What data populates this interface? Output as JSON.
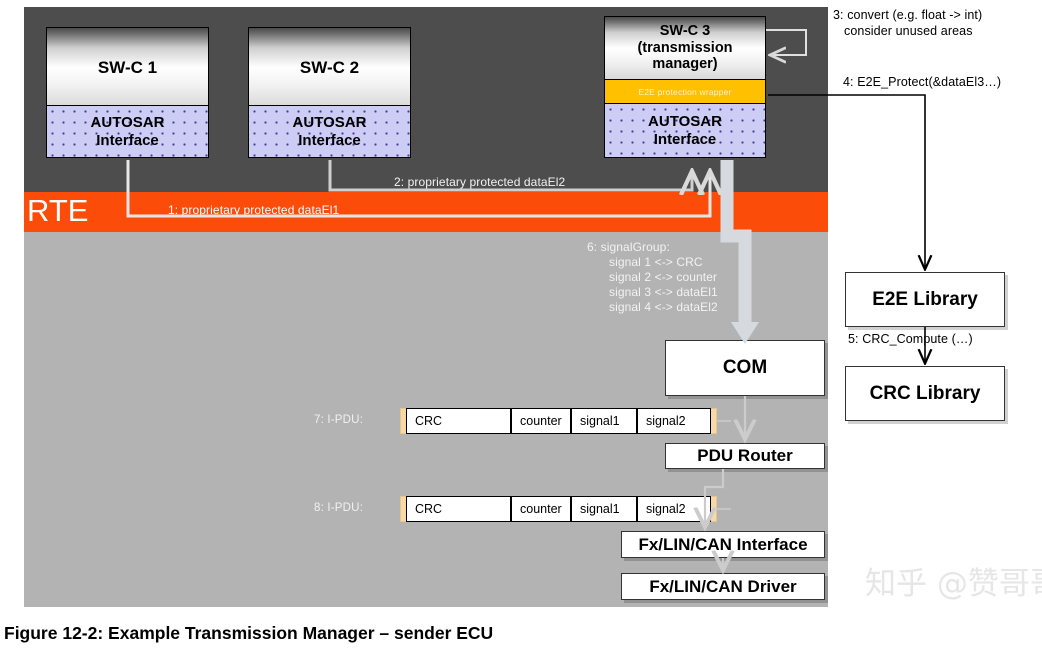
{
  "figure": {
    "caption": "Figure 12-2: Example Transmission Manager – sender ECU",
    "watermark": "知乎 @赞哥哥"
  },
  "layers": {
    "rte_label": "RTE"
  },
  "components": [
    {
      "id": "swc1",
      "title": "SW-C 1",
      "interface": "AUTOSAR\nInterface"
    },
    {
      "id": "swc2",
      "title": "SW-C 2",
      "interface": "AUTOSAR\nInterface"
    },
    {
      "id": "swc3",
      "title": "SW-C 3\n(transmission\nmanager)",
      "interface": "AUTOSAR\nInterface",
      "wrapper": "E2E protection wrapper"
    }
  ],
  "component_labels": {
    "swc1_title": "SW-C 1",
    "swc1_if_line1": "AUTOSAR",
    "swc1_if_line2": "Interface",
    "swc2_title": "SW-C 2",
    "swc2_if_line1": "AUTOSAR",
    "swc2_if_line2": "Interface",
    "swc3_title_line1": "SW-C 3",
    "swc3_title_line2": "(transmission",
    "swc3_title_line3": "manager)",
    "swc3_wrapper": "E2E protection wrapper",
    "swc3_if_line1": "AUTOSAR",
    "swc3_if_line2": "Interface"
  },
  "basic_software": {
    "com": "COM",
    "pdu_router": "PDU Router",
    "fx_lin_can_interface": "Fx/LIN/CAN Interface",
    "fx_lin_can_driver": "Fx/LIN/CAN Driver"
  },
  "libraries": {
    "e2e": "E2E Library",
    "crc": "CRC Library"
  },
  "annotations": {
    "step1": "1: proprietary protected dataEl1",
    "step2": "2: proprietary protected dataEl2",
    "step3_line1": "3: convert (e.g. float -> int)",
    "step3_line2": "consider unused areas",
    "step4": "4: E2E_Protect(&dataEl3…)",
    "step5": "5: CRC_Compute (…)",
    "step6_line1": "6: signalGroup:",
    "step6_line2": "signal 1 <-> CRC",
    "step6_line3": "signal 2 <-> counter",
    "step6_line4": "signal 3 <-> dataEl1",
    "step6_line5": "signal 4 <-> dataEl2",
    "step7": "7: I-PDU:",
    "step8": "8: I-PDU:"
  },
  "ipdu": {
    "row7_cells": [
      "CRC",
      "counter",
      "signal1",
      "signal2"
    ],
    "row8_cells": [
      "CRC",
      "counter",
      "signal1",
      "signal2"
    ]
  },
  "colors": {
    "rte_orange": "#fb4c09",
    "application_layer_dark": "#4d4d4d",
    "basic_software_gray": "#b3b3b3",
    "autosar_interface_lavender": "#ccccf5",
    "e2e_wrapper_amber": "#ffc000",
    "ipdu_strip_tan": "#f8d9a6",
    "arrow_light_gray": "#d9d9d9"
  }
}
